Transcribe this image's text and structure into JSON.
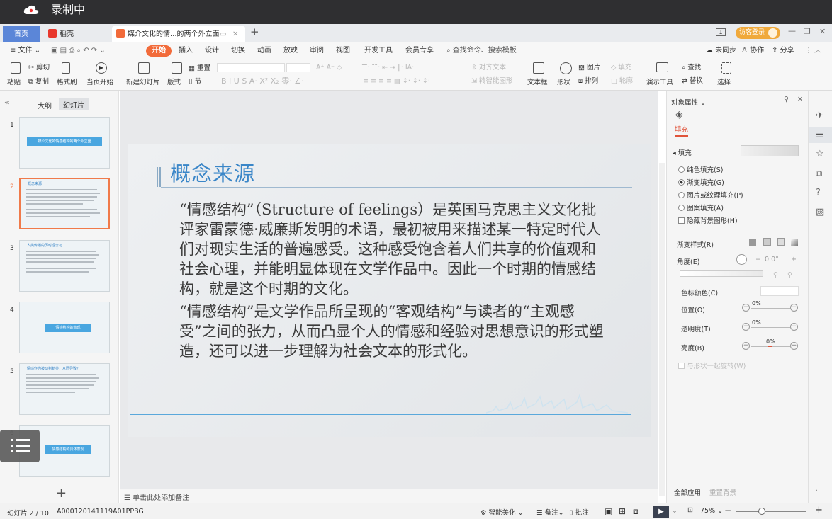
{
  "recording": {
    "label": "录制中"
  },
  "tabs": {
    "home": "首页",
    "daoke": "稻壳",
    "doc": "媒介文化的情...的两个外立面"
  },
  "window": {
    "login": "访客登录"
  },
  "menu": {
    "file": "文件",
    "items": [
      "开始",
      "插入",
      "设计",
      "切换",
      "动画",
      "放映",
      "审阅",
      "视图",
      "开发工具",
      "会员专享"
    ],
    "search": "查找命令、搜索模板",
    "sync": "未同步",
    "collab": "协作",
    "share": "分享"
  },
  "ribbon": {
    "paste": "粘贴",
    "cut": "剪切",
    "copy": "复制",
    "format_painter": "格式刷",
    "play": "当页开始",
    "new_slide": "新建幻灯片",
    "layout": "版式",
    "section": "节",
    "reset": "重置",
    "align": "对齐文本",
    "smart": "转智能图形",
    "textbox": "文本框",
    "shape": "形状",
    "arrange": "排列",
    "picture": "图片",
    "fill": "填充",
    "outline": "轮廓",
    "present": "演示工具",
    "find": "查找",
    "replace": "替换",
    "select": "选择"
  },
  "left": {
    "outline_tab": "大纲",
    "slides_tab": "幻灯片",
    "thumb1": "媒介文化的情感结构的两个外立面",
    "thumb2": "概念来源",
    "thumb3": "人类传播的历时理念与",
    "thumb4": "情感结构的表现",
    "thumb5": "情感作为被动判断类，从而导致？",
    "thumb6": "情感结构的具体表现"
  },
  "slide": {
    "title": "概念来源",
    "para1": "“情感结构”（Structure of feelings）是英国马克思主义文化批评家雷蒙德·威廉斯发明的术语，最初被用来描述某一特定时代人们对现实生活的普遍感受。这种感受饱含着人们共享的价值观和社会心理，并能明显体现在文学作品中。因此一个时期的情感结构，就是这个时期的文化。",
    "para2": "“情感结构”是文学作品所呈现的“客观结构”与读者的“主观感受”之间的张力，从而凸显个人的情感和经验对思想意识的形式塑造，还可以进一步理解为社会文本的形式化。"
  },
  "notes": {
    "placeholder": "单击此处添加备注"
  },
  "panel": {
    "header": "对象属性",
    "fill_tab": "填充",
    "fill_section": "填充",
    "options": [
      "纯色填充(S)",
      "渐变填充(G)",
      "图片或纹理填充(P)",
      "图案填充(A)"
    ],
    "hide_bg": "隐藏背景图形(H)",
    "grad_style": "渐变样式(R)",
    "angle": "角度(E)",
    "angle_val": "0.0°",
    "stop_color": "色标颜色(C)",
    "position": "位置(O)",
    "transparency": "透明度(T)",
    "brightness": "亮度(B)",
    "pos_val": "0%",
    "trans_val": "0%",
    "bright_val": "0%",
    "rotate": "与形状一起旋转(W)",
    "apply_all": "全部应用",
    "reset_bg": "重置背景"
  },
  "status": {
    "slide_no": "幻灯片 2 / 10",
    "id": "A000120141119A01PPBG",
    "beautify": "智能美化",
    "notes": "备注",
    "comment": "批注",
    "zoom": "75%"
  }
}
